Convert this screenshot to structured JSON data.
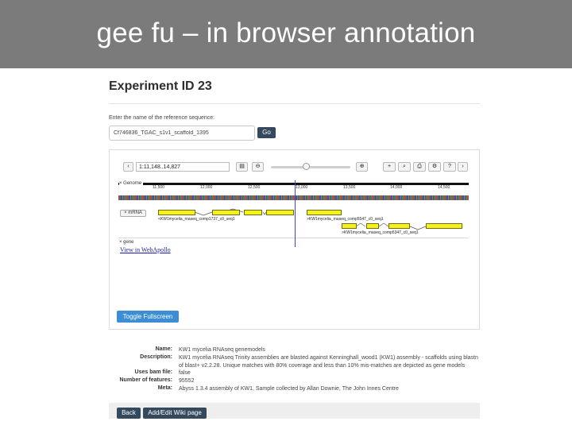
{
  "slide": {
    "title": "gee fu – in browser annotation"
  },
  "page": {
    "title": "Experiment ID 23"
  },
  "reference": {
    "label": "Enter the name of the reference sequence:",
    "value": "Cf746836_TGAC_s1v1_scaffold_1395",
    "go_label": "Go"
  },
  "browser": {
    "location": "1:11,148..14,827",
    "toolbar": {
      "back": "‹",
      "doc": "▤",
      "zoom_out": "⊖",
      "zoom_in": "⊕",
      "plus": "+",
      "binoculars": "⌕",
      "print": "⎙",
      "gear": "⚙",
      "help": "?",
      "forward": "›"
    },
    "zoom_level": 0.45,
    "genome_track_label": "× Genome",
    "ticks": [
      "11,500",
      "12,000",
      "12,500",
      "13,000",
      "13,500",
      "14,000",
      "14,500"
    ],
    "mrna_track_label": "× mRNA",
    "gene_track_label": "× gene",
    "features": [
      "<KW1mycelia_rnaseq_comp1737_c0_seq1",
      ">KW1mycelia_rnaseq_comp5547_c0_seq1",
      ">KW1mycelia_rnaseq_comp5347_c0_seq1"
    ],
    "feature_color": "#f7f31a",
    "cursor_color": "#3a4ad0"
  },
  "links": {
    "view_in_webapollo": "View in WebApollo"
  },
  "buttons": {
    "toggle_fullscreen": "Toggle Fullscreen",
    "back": "Back",
    "wiki": "Add/Edit Wiki page"
  },
  "meta": {
    "name_key": "Name:",
    "name_val": "KW1 mycelia RNAseq genemodels",
    "description_key": "Description:",
    "description_val": "KW1 mycelia RNAseq Trinity assemblies are blasted against Kenninghall_wood1 (KW1) assembly - scaffolds using blastn of blast+ v2.2.28. Unique matches with 80% coverage and less than 10% mis-matches are depicted as gene models",
    "bam_key": "Uses bam file:",
    "bam_val": "false",
    "features_key": "Number of features:",
    "features_val": "95552",
    "meta_key": "Meta:",
    "meta_val": "Abyss 1.3.4 assembly of KW1, Sample collected by Allan Downie, The John Innes Centre"
  },
  "colors": {
    "banner": "#7b7b7b",
    "primary_button": "#34495e",
    "fullscreen_button": "#3b8dd6"
  }
}
